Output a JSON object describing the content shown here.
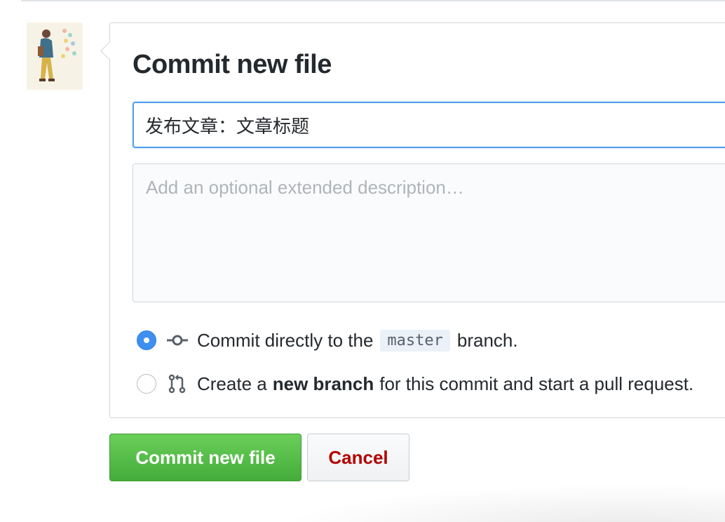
{
  "colors": {
    "primary_green": "#5cb94c",
    "focus_blue": "#52a0ee",
    "radio_blue": "#3f8ff0",
    "cancel_red": "#b30000",
    "border_gray": "#d1d5da"
  },
  "avatar": {
    "icon": "user-avatar-illustration"
  },
  "commit_form": {
    "title": "Commit new file",
    "summary_value": "发布文章：文章标题",
    "description_placeholder": "Add an optional extended description…",
    "description_value": "",
    "options": [
      {
        "icon": "git-commit-icon",
        "checked": true,
        "text_before": "Commit directly to the",
        "branch": "master",
        "text_after": "branch."
      },
      {
        "icon": "git-pull-request-icon",
        "checked": false,
        "text_before": "Create a",
        "bold": "new branch",
        "text_after": "for this commit and start a pull request."
      }
    ]
  },
  "buttons": {
    "commit_label": "Commit new file",
    "cancel_label": "Cancel"
  }
}
